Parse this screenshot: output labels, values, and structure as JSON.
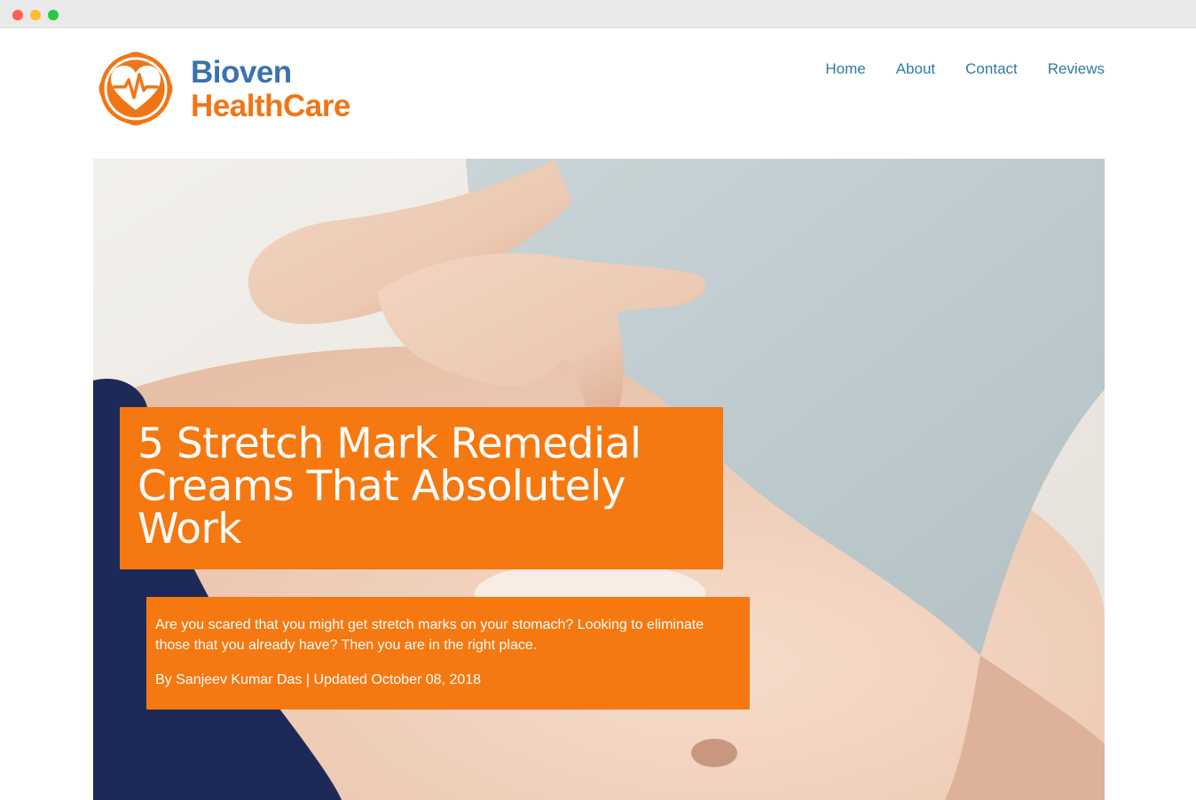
{
  "brand": {
    "line1": "Bioven",
    "line2": "HealthCare",
    "colors": {
      "blue": "#3a73ad",
      "orange": "#f07516"
    },
    "icon": "heart-pulse-icon"
  },
  "nav": {
    "items": [
      {
        "label": "Home"
      },
      {
        "label": "About"
      },
      {
        "label": "Contact"
      },
      {
        "label": "Reviews"
      }
    ],
    "color": "#2e7ba3"
  },
  "hero": {
    "title": "5 Stretch Mark Remedial Creams That Absolutely Work",
    "description": "Are you scared that you might get stretch marks on your stomach? Looking to eliminate those that you already have? Then you are in the right place.",
    "byline": "By Sanjeev Kumar Das | Updated October 08, 2018",
    "accent": "#f57810"
  }
}
